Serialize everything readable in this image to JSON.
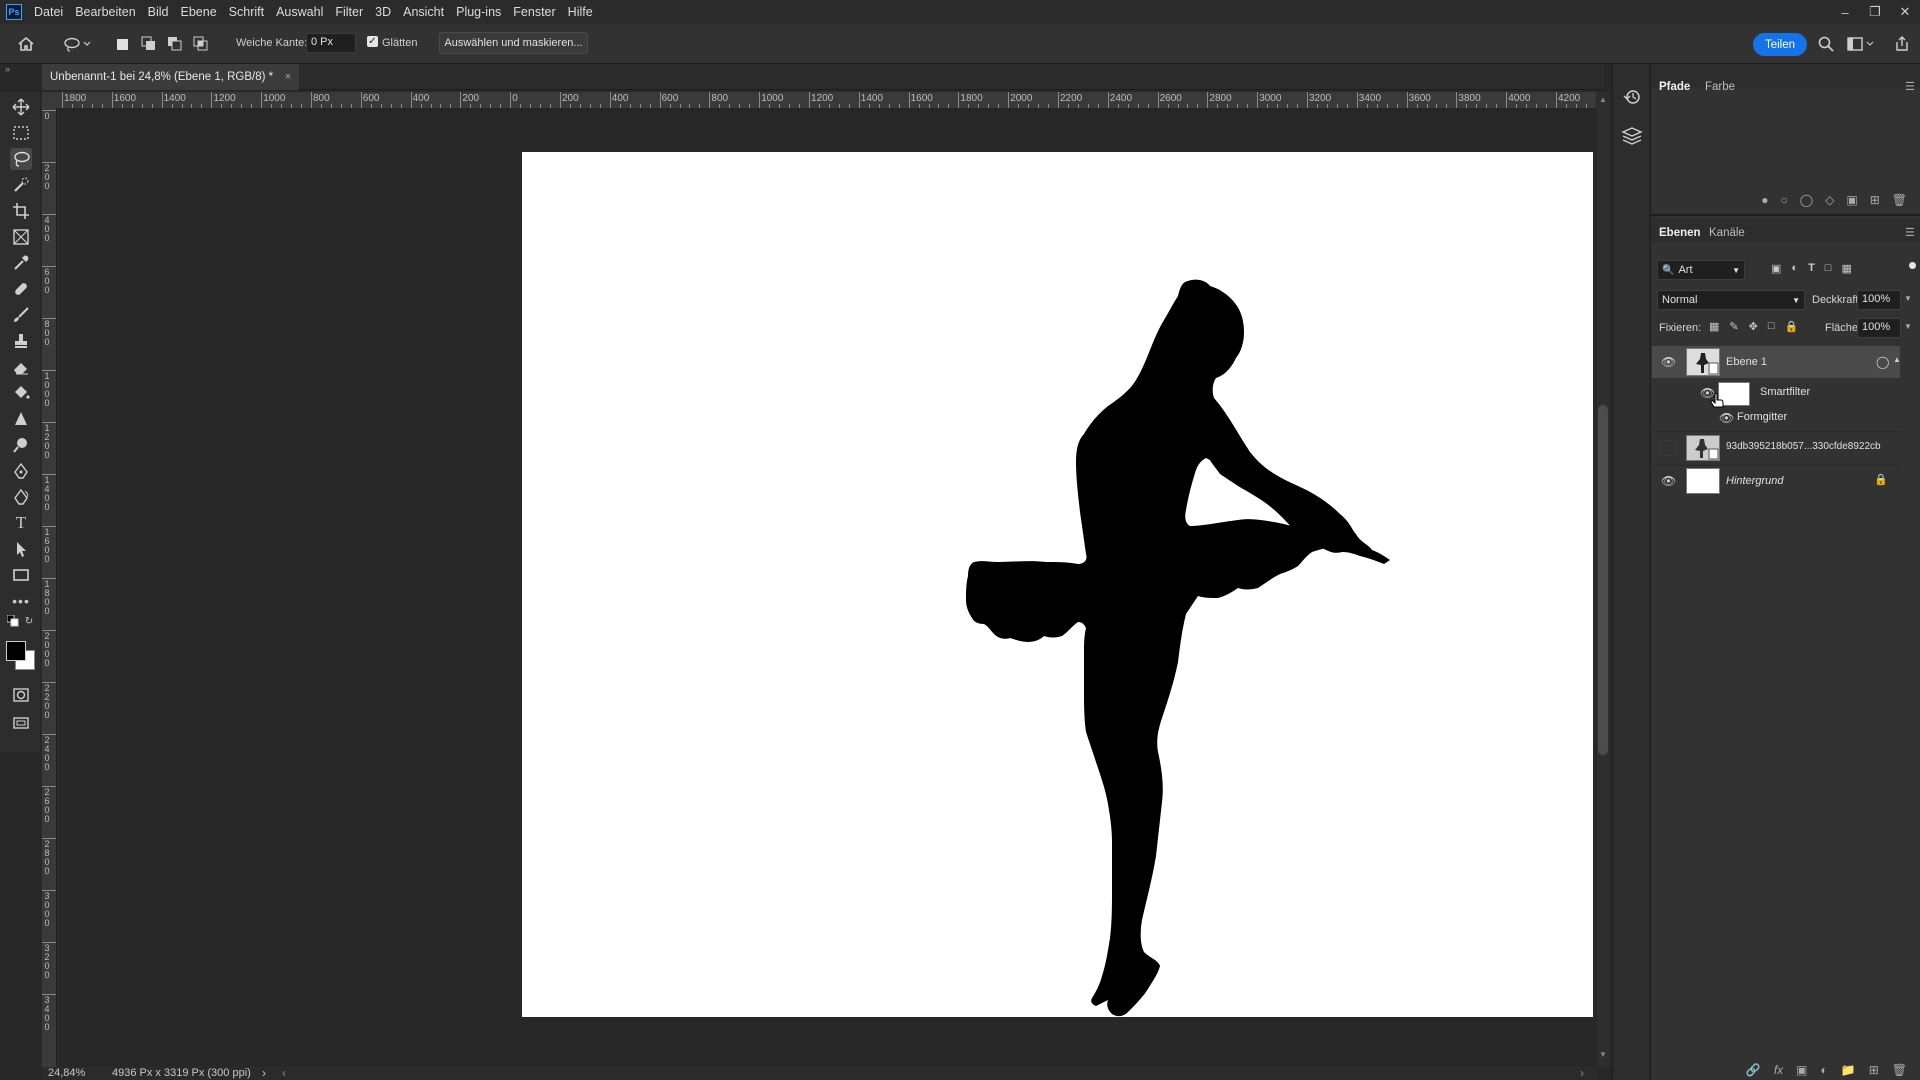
{
  "menubar": {
    "logo": "Ps",
    "items": [
      "Datei",
      "Bearbeiten",
      "Bild",
      "Ebene",
      "Schrift",
      "Auswahl",
      "Filter",
      "3D",
      "Ansicht",
      "Plug-ins",
      "Fenster",
      "Hilfe"
    ],
    "window_controls": [
      "minimize-icon",
      "restore-icon",
      "close-icon"
    ]
  },
  "options": {
    "feather_label": "Weiche Kante:",
    "feather_value": "0 Px",
    "antialias_label": "Glätten",
    "antialias_checked": true,
    "select_mask_label": "Auswählen und maskieren...",
    "share_label": "Teilen"
  },
  "document": {
    "tab_title": "Unbenannt-1 bei 24,8% (Ebene 1, RGB/8) *",
    "tab_close": "×",
    "ruler_h": [
      "1800",
      "1600",
      "1400",
      "1200",
      "1000",
      "800",
      "600",
      "400",
      "200",
      "0",
      "200",
      "400",
      "600",
      "800",
      "1000",
      "1200",
      "1400",
      "1600",
      "1800",
      "2000",
      "2200",
      "2400",
      "2600",
      "2800",
      "3000",
      "3200",
      "3400",
      "3600",
      "3800",
      "4000",
      "4200"
    ],
    "ruler_v": [
      "0",
      "2 0 0",
      "4 0 0",
      "6 0 0",
      "8 0 0",
      "1 0 0 0",
      "1 2 0 0",
      "1 4 0 0",
      "1 6 0 0",
      "1 8 0 0",
      "2 0 0 0",
      "2 2 0 0",
      "2 4 0 0",
      "2 6 0 0",
      "2 8 0 0",
      "3 0 0 0",
      "3 2 0 0",
      "3 4 0 0"
    ]
  },
  "status": {
    "zoom": "24,84%",
    "doc_info": "4936 Px x 3319 Px (300 ppi)",
    "arrow": "›"
  },
  "panels": {
    "top_tabs": [
      "Pfade",
      "Farbe"
    ],
    "layers_tabs": [
      "Ebenen",
      "Kanäle"
    ],
    "filter_placeholder": "Art",
    "blend_mode": "Normal",
    "opacity_label": "Deckkraft:",
    "opacity_value": "100%",
    "lock_label": "Fixieren:",
    "fill_label": "Fläche:",
    "fill_value": "100%",
    "layers": [
      {
        "name": "Ebene 1",
        "visible": true,
        "selected": true
      },
      {
        "name": "Smartfilter",
        "visible": true,
        "indent": 1
      },
      {
        "name": "Formgitter",
        "visible": true,
        "indent": 2
      },
      {
        "name": "93db395218b057...330cfde8922cb",
        "visible": false
      },
      {
        "name": "Hintergrund",
        "visible": true,
        "locked": true,
        "italic": true
      }
    ]
  },
  "colors": {
    "accent": "#1473e6",
    "canvas": "#ffffff",
    "workspace": "#282828"
  }
}
